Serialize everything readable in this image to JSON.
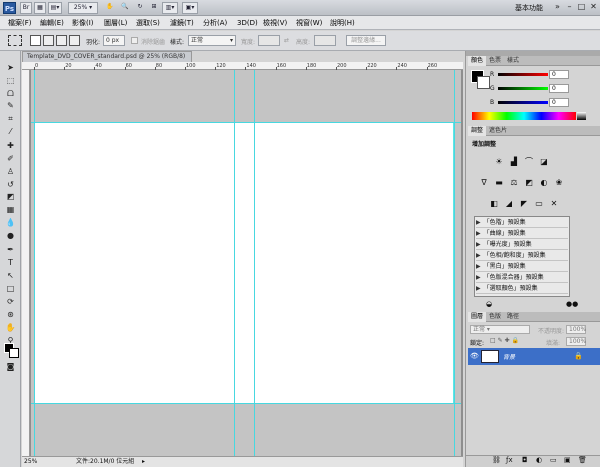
{
  "app": {
    "logo": "Ps",
    "zoom_display": "25%",
    "workspace": "基本功能"
  },
  "menu": [
    "檔案(F)",
    "編輯(E)",
    "影像(I)",
    "圖層(L)",
    "選取(S)",
    "濾鏡(T)",
    "分析(A)",
    "3D(D)",
    "檢視(V)",
    "視窗(W)",
    "說明(H)"
  ],
  "options": {
    "feather_label": "羽化:",
    "feather_value": "0 px",
    "antialias_label": "消除鋸齒",
    "style_label": "樣式:",
    "style_value": "正常",
    "width_label": "寬度:",
    "height_label": "高度:",
    "refine_label": "調整邊緣..."
  },
  "document": {
    "tab_title": "Template_DVD_COVER_standard.psd @ 25% (RGB/8)",
    "ruler_ticks": [
      "0",
      "20",
      "40",
      "60",
      "80",
      "100",
      "120",
      "140",
      "160",
      "180",
      "200",
      "220",
      "240",
      "260"
    ],
    "status_zoom": "25%",
    "status_text": "文件:20.1M/0 位元組"
  },
  "color_panel": {
    "tabs": [
      "顏色",
      "色票",
      "樣式"
    ],
    "r_label": "R",
    "g_label": "G",
    "b_label": "B",
    "r_value": "0",
    "g_value": "0",
    "b_value": "0"
  },
  "adjust_panel": {
    "tabs": [
      "調整",
      "遮色片"
    ],
    "header": "增加調整",
    "presets": [
      "「色階」預設集",
      "「曲線」預設集",
      "「曝光度」預設集",
      "「色相/飽和度」預設集",
      "「黑白」預設集",
      "「色版混合器」預設集",
      "「選取顏色」預設集"
    ]
  },
  "layers_panel": {
    "tabs": [
      "圖層",
      "色版",
      "路徑"
    ],
    "blend_mode": "正常",
    "opacity_label": "不透明度:",
    "opacity_value": "100%",
    "lock_label": "鎖定:",
    "fill_label": "填滿:",
    "fill_value": "100%",
    "layer_name": "背景"
  },
  "colors": {
    "accent": "#3c6fc8",
    "guide": "#47d8e0"
  }
}
